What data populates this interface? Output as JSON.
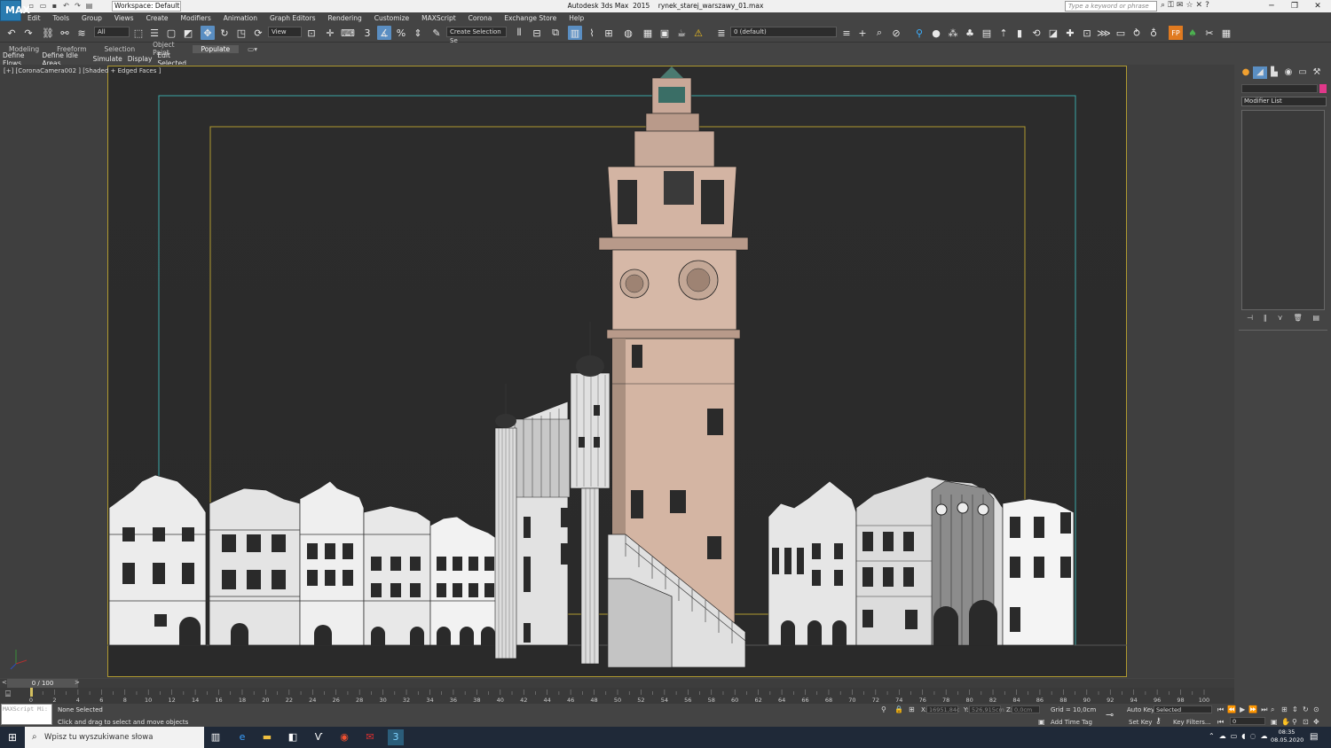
{
  "titlebar": {
    "workspace_label": "Workspace: Default",
    "window_title": "Autodesk 3ds Max  2015    rynek_starej_warszawy_01.max",
    "search_placeholder": "Type a keyword or phrase",
    "app_icon_label": "MAX"
  },
  "menu": {
    "items": [
      "Edit",
      "Tools",
      "Group",
      "Views",
      "Create",
      "Modifiers",
      "Animation",
      "Graph Editors",
      "Rendering",
      "Customize",
      "MAXScript",
      "Corona",
      "Exchange Store",
      "Help"
    ]
  },
  "toolbar": {
    "selection_filter": "All",
    "reference_coord": "View",
    "named_selection": "Create Selection Se",
    "layer": "0 (default)"
  },
  "ribbon": {
    "tabs": [
      "Modeling",
      "Freeform",
      "Selection",
      "Object Paint",
      "Populate"
    ],
    "active_tab": "Populate",
    "commands": [
      "Define Flows",
      "Define Idle Areas",
      "Simulate",
      "Display",
      "Edit Selected"
    ]
  },
  "viewport": {
    "label": "[+] [CoronaCamera002 ] [Shaded + Edged Faces ]"
  },
  "command_panel": {
    "modifier_list": "Modifier List",
    "swatch_color": "#e0388a"
  },
  "timeline": {
    "frame_display": "0 / 100",
    "ticks": [
      "0",
      "2",
      "4",
      "6",
      "8",
      "10",
      "12",
      "14",
      "16",
      "18",
      "20",
      "22",
      "24",
      "26",
      "28",
      "30",
      "32",
      "34",
      "36",
      "38",
      "40",
      "42",
      "44",
      "46",
      "48",
      "50",
      "52",
      "54",
      "56",
      "58",
      "60",
      "62",
      "64",
      "66",
      "68",
      "70",
      "72",
      "74",
      "76",
      "78",
      "80",
      "82",
      "84",
      "86",
      "88",
      "90",
      "92",
      "94",
      "96",
      "98",
      "100"
    ]
  },
  "status": {
    "maxscript_placeholder": "MAXScript Mi:",
    "selection_status": "None Selected",
    "prompt": "Click and drag to select and move objects",
    "x_label": "X:",
    "x_value": "16951,84c",
    "y_label": "Y:",
    "y_value": "526,915cm",
    "z_label": "Z:",
    "z_value": "0,0cm",
    "grid": "Grid = 10,0cm",
    "add_time_tag": "Add Time Tag",
    "auto_key": "Auto Key",
    "key_mode": "Selected",
    "set_key": "Set Key",
    "key_filters": "Key Filters...",
    "current_frame": "0"
  },
  "taskbar": {
    "search_placeholder": "Wpisz tu wyszukiwane słowa",
    "time": "08:35",
    "date": "08.05.2020"
  }
}
